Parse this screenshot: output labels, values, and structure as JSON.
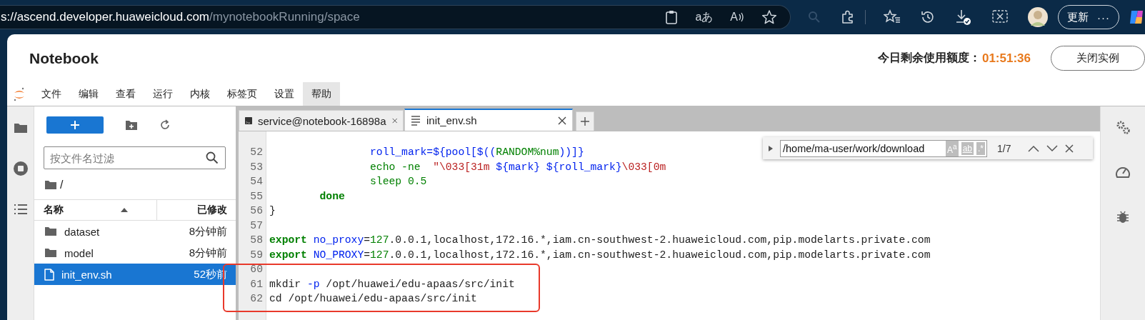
{
  "browser": {
    "url_host": "s://ascend.developer.huaweicloud.com",
    "url_path": "/mynotebookRunning/space",
    "translate_text": "aあ",
    "read_aloud_text": "A",
    "update_button": "更新",
    "more_button": "···"
  },
  "header": {
    "title": "Notebook",
    "quota_label": "今日剩余使用额度：",
    "quota_time": "01:51:36",
    "close_button": "关闭实例"
  },
  "menu": [
    {
      "label": "文件",
      "selected": false
    },
    {
      "label": "编辑",
      "selected": false
    },
    {
      "label": "查看",
      "selected": false
    },
    {
      "label": "运行",
      "selected": false
    },
    {
      "label": "内核",
      "selected": false
    },
    {
      "label": "标签页",
      "selected": false
    },
    {
      "label": "设置",
      "selected": false
    },
    {
      "label": "帮助",
      "selected": true
    }
  ],
  "file_browser": {
    "filter_placeholder": "按文件名过滤",
    "path": "/",
    "name_column": "名称",
    "modified_column": "已修改",
    "files": [
      {
        "kind": "folder",
        "name": "dataset",
        "modified": "8分钟前",
        "selected": false
      },
      {
        "kind": "folder",
        "name": "model",
        "modified": "8分钟前",
        "selected": false
      },
      {
        "kind": "file",
        "name": "init_env.sh",
        "modified": "52秒前",
        "selected": true
      }
    ]
  },
  "editor": {
    "tabs": [
      {
        "kind": "terminal",
        "label": "service@notebook-16898a",
        "selected": false
      },
      {
        "kind": "file",
        "label": "init_env.sh",
        "selected": true
      }
    ],
    "lines": [
      {
        "number": "52",
        "tokens": [
          {
            "kind": "var",
            "text": "                roll_mark=${pool[$(("
          },
          {
            "kind": "number",
            "text": "RANDOM%num"
          },
          {
            "kind": "var",
            "text": "))]}"
          }
        ]
      },
      {
        "number": "53",
        "tokens": [
          {
            "kind": "builtin",
            "text": "                echo -ne  "
          },
          {
            "kind": "string",
            "text": "\"\\033[31m "
          },
          {
            "kind": "var",
            "text": "${mark}"
          },
          {
            "kind": "var",
            "text": " ${roll_mark}"
          },
          {
            "kind": "string",
            "text": "\\033[0m"
          }
        ]
      },
      {
        "number": "54",
        "tokens": [
          {
            "kind": "builtin",
            "text": "                sleep "
          },
          {
            "kind": "number",
            "text": "0.5"
          }
        ]
      },
      {
        "number": "55",
        "tokens": [
          {
            "kind": "keyword",
            "text": "        done"
          }
        ]
      },
      {
        "number": "56",
        "tokens": [
          {
            "kind": "plain",
            "text": "}"
          }
        ]
      },
      {
        "number": "57"
      },
      {
        "number": "58",
        "tokens": [
          {
            "kind": "keyword",
            "text": "export "
          },
          {
            "kind": "var",
            "text": "no_proxy"
          },
          {
            "kind": "plain",
            "text": "="
          },
          {
            "kind": "number",
            "text": "127"
          },
          {
            "kind": "plain",
            "text": ".0.0.1,localhost,172.16.*,iam.cn-southwest-2.huaweicloud.com,pip.modelarts.private.com"
          }
        ]
      },
      {
        "number": "59",
        "tokens": [
          {
            "kind": "keyword",
            "text": "export "
          },
          {
            "kind": "var",
            "text": "NO_PROXY"
          },
          {
            "kind": "plain",
            "text": "="
          },
          {
            "kind": "number",
            "text": "127"
          },
          {
            "kind": "plain",
            "text": ".0.0.1,localhost,172.16.*,iam.cn-southwest-2.huaweicloud.com,pip.modelarts.private.com"
          }
        ]
      },
      {
        "number": "60"
      },
      {
        "number": "61",
        "tokens": [
          {
            "kind": "plain",
            "text": "mkdir"
          },
          {
            "kind": "var",
            "text": " -p"
          },
          {
            "kind": "plain",
            "text": " /opt/huawei/edu-apaas/src/init"
          }
        ]
      },
      {
        "number": "62",
        "tokens": [
          {
            "kind": "plain",
            "text": "cd /opt/huawei/edu-apaas/src/init"
          }
        ]
      }
    ],
    "find": {
      "value": "/home/ma-user/work/download",
      "match_case": "A$^{a}$",
      "whole_word": "ab",
      "regex": ".*",
      "count": "1/7"
    }
  }
}
